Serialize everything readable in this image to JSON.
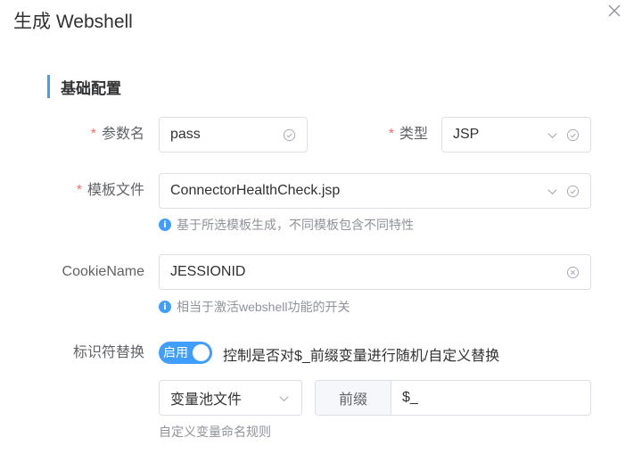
{
  "dialog": {
    "title": "生成 Webshell"
  },
  "section": {
    "title": "基础配置"
  },
  "form": {
    "required_mark": "*",
    "param_name": {
      "label": "参数名",
      "value": "pass"
    },
    "type": {
      "label": "类型",
      "value": "JSP"
    },
    "template": {
      "label": "模板文件",
      "value": "ConnectorHealthCheck.jsp",
      "hint": "基于所选模板生成，不同模板包含不同特性"
    },
    "cookie": {
      "label": "CookieName",
      "value": "JESSIONID",
      "hint": "相当于激活webshell功能的开关"
    },
    "identifier": {
      "label": "标识符替换",
      "switch_text": "启用",
      "switch_on": true,
      "description": "控制是否对$_前缀变量进行随机/自定义替换",
      "source_value": "变量池文件",
      "prefix_label": "前缀",
      "prefix_value": "$_",
      "rule_hint": "自定义变量命名规则"
    }
  },
  "info_glyph": "i",
  "colors": {
    "accent": "#409eff",
    "required": "#f56c6c",
    "border": "#dcdfe6",
    "hint": "#909399"
  },
  "icons": [
    "close-icon",
    "check-circle-icon",
    "chevron-down-icon",
    "clear-circle-icon",
    "info-icon"
  ]
}
